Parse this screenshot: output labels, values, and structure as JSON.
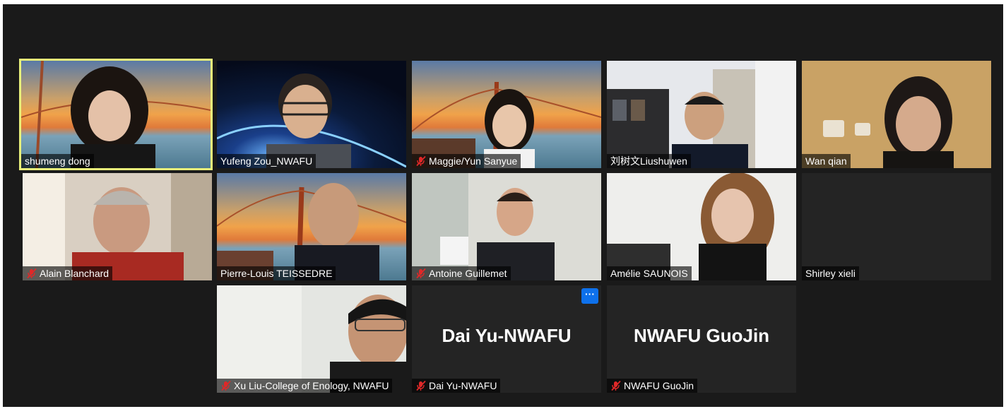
{
  "gallery": {
    "participants": [
      {
        "name": "shumeng dong",
        "muted": false,
        "active": true
      },
      {
        "name": "Yufeng Zou_NWAFU",
        "muted": false
      },
      {
        "name": "Maggie/Yun Sanyue",
        "muted": true
      },
      {
        "name": "刘树文Liushuwen",
        "muted": false
      },
      {
        "name": "Wan qian",
        "muted": false
      },
      {
        "name": "Alain Blanchard",
        "muted": true
      },
      {
        "name": "Pierre-Louis TEISSEDRE",
        "muted": false
      },
      {
        "name": "Antoine Guillemet",
        "muted": true
      },
      {
        "name": "Amélie SAUNOIS",
        "muted": false
      },
      {
        "name": "Shirley xieli",
        "muted": false,
        "video": false
      },
      {
        "name": "Xu Liu-College of Enology, NWAFU",
        "muted": true
      },
      {
        "name": "Dai Yu-NWAFU",
        "muted": true,
        "video": false,
        "display_name": "Dai Yu-NWAFU",
        "more_label": "···"
      },
      {
        "name": "NWAFU GuoJin",
        "muted": true,
        "video": false,
        "display_name": "NWAFU GuoJin"
      }
    ]
  },
  "colors": {
    "background": "#1a1a1a",
    "tile": "#242424",
    "active_speaker_border": "#e8f07a",
    "muted_icon": "#e02828",
    "more_button": "#0e71eb"
  },
  "icons": {
    "muted": "microphone-muted-icon",
    "more": "more-options-icon"
  }
}
